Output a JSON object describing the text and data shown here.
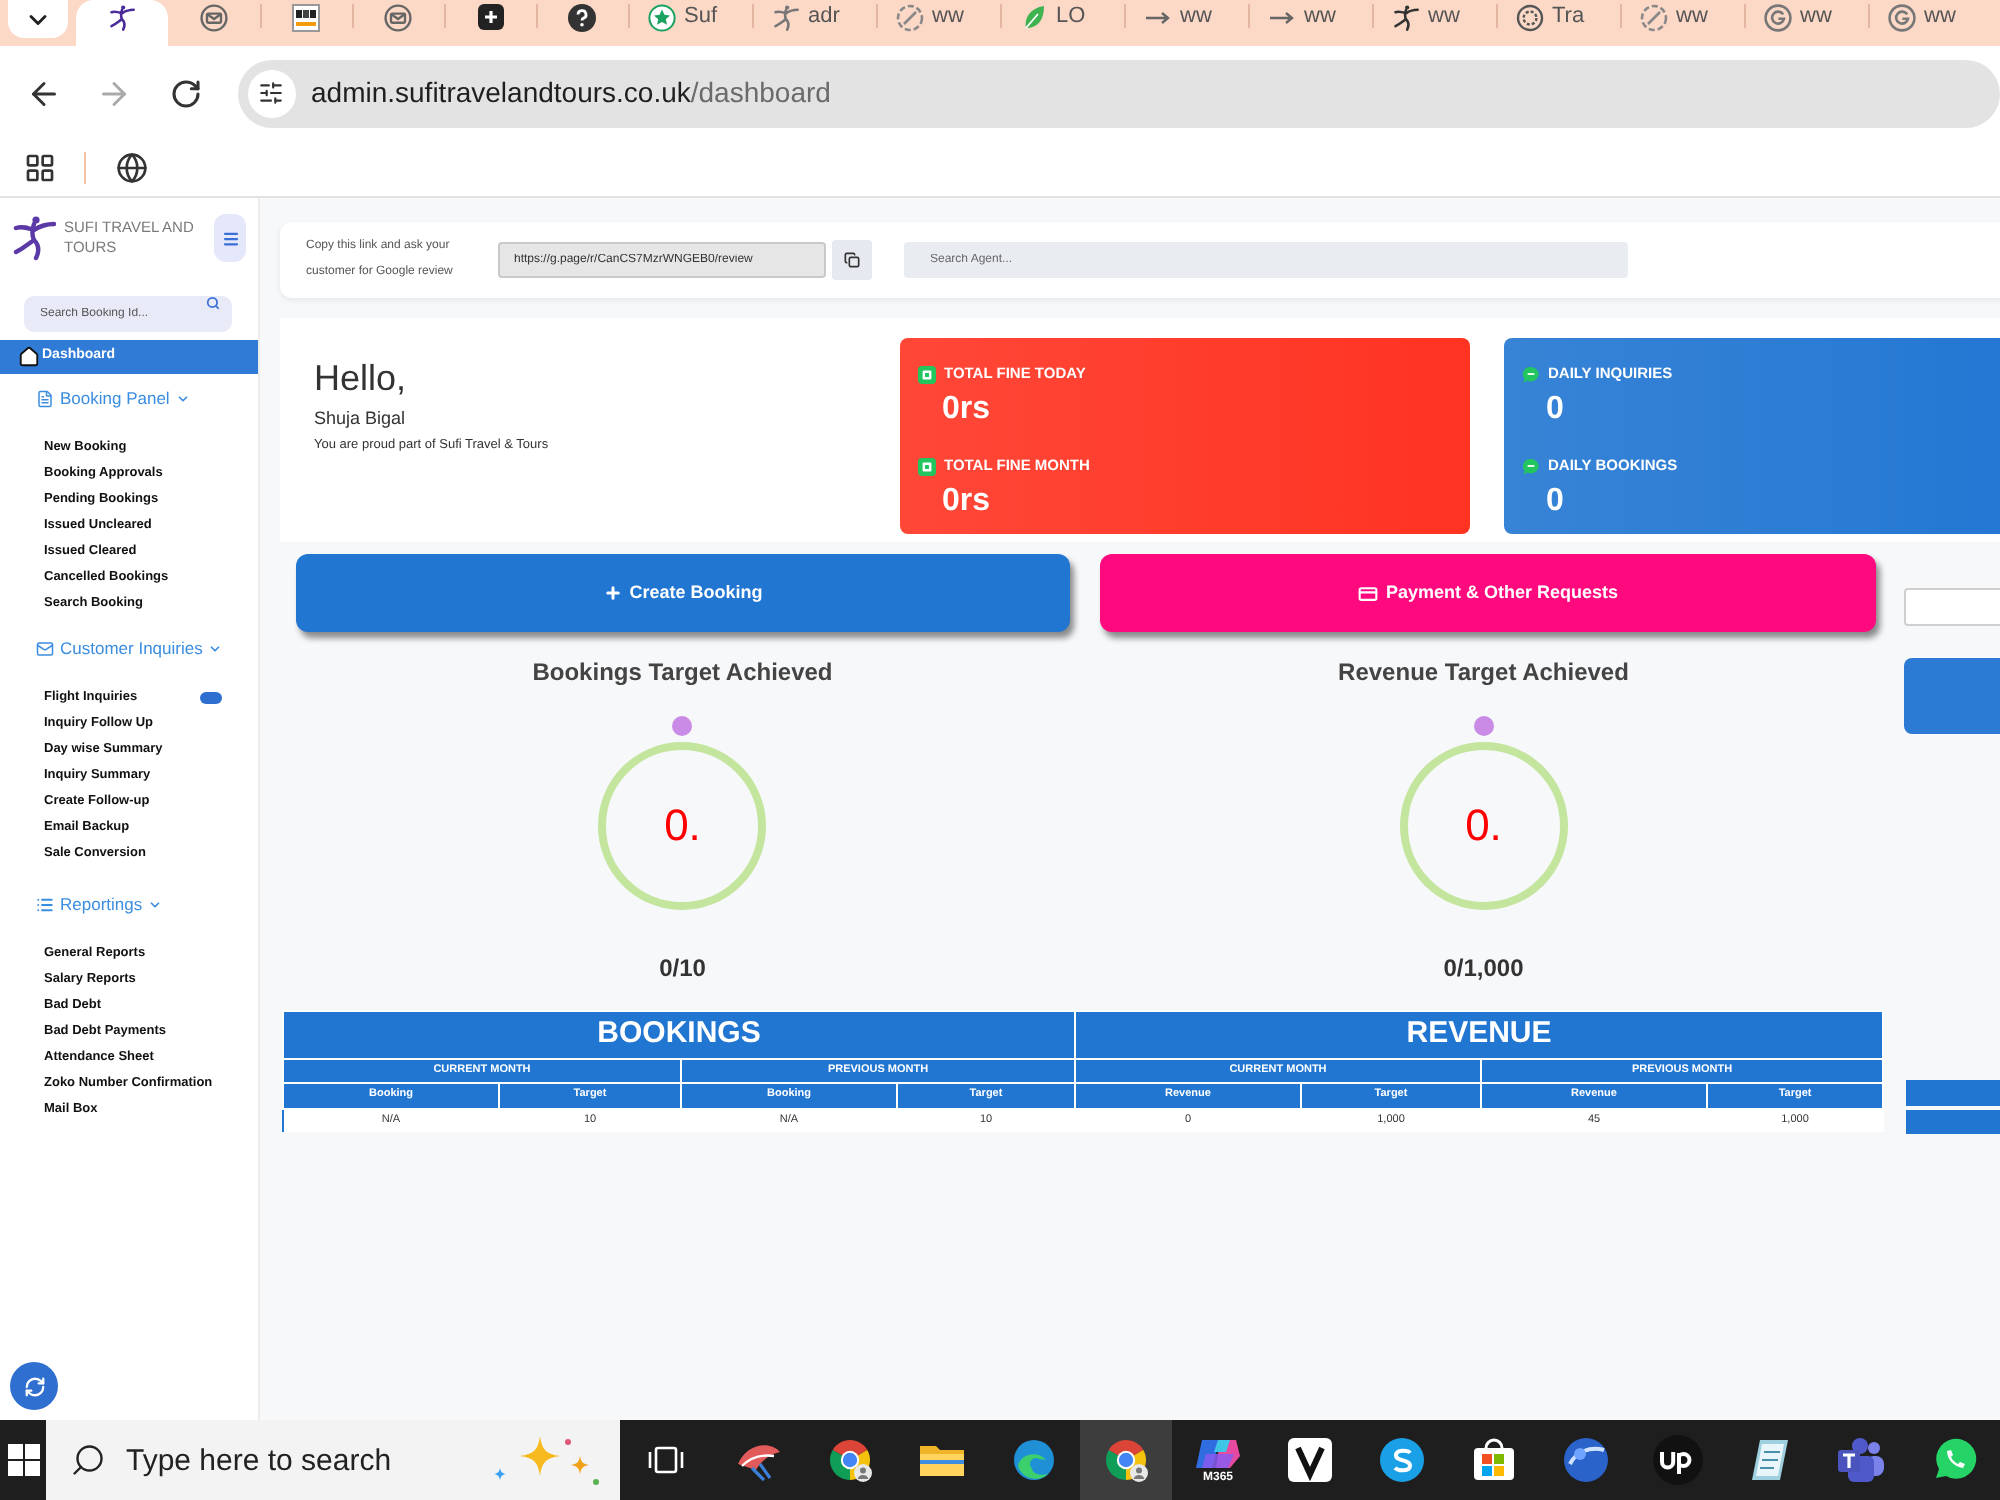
{
  "browser": {
    "tabs": [
      {
        "selected": true
      },
      {
        "selected": false
      },
      {
        "selected": false
      },
      {
        "selected": false
      },
      {
        "selected": false
      },
      {
        "selected": false
      },
      {
        "title": "Suf",
        "selected": false
      },
      {
        "title": "adr",
        "selected": false
      },
      {
        "title": "ww",
        "selected": false
      },
      {
        "title": "LO",
        "selected": false
      },
      {
        "title": "ww",
        "selected": false
      },
      {
        "title": "ww",
        "selected": false
      },
      {
        "title": "ww",
        "selected": false
      },
      {
        "title": "Tra",
        "selected": false
      },
      {
        "title": "ww",
        "selected": false
      },
      {
        "title": "ww",
        "selected": false
      },
      {
        "title": "ww",
        "selected": false
      }
    ],
    "address": {
      "host": "admin.sufitravelandtours.co.uk",
      "path": "/dashboard"
    }
  },
  "sidebar": {
    "brand": "SUFI TRAVEL AND TOURS",
    "search": {
      "placeholder": "Search Booking Id..."
    },
    "items": [
      {
        "kind": "link",
        "label": "Dashboard",
        "selected": true
      },
      {
        "kind": "section",
        "label": "Booking Panel",
        "expanded": true,
        "children": [
          {
            "label": "New Booking",
            "badge": false
          },
          {
            "label": "Booking Approvals",
            "badge": false
          },
          {
            "label": "Pending Bookings",
            "badge": false
          },
          {
            "label": "Issued Uncleared",
            "badge": false
          },
          {
            "label": "Issued Cleared",
            "badge": false
          },
          {
            "label": "Cancelled Bookings",
            "badge": false
          },
          {
            "label": "Search Booking",
            "badge": false
          }
        ]
      },
      {
        "kind": "section",
        "label": "Customer Inquiries",
        "expanded": true,
        "children": [
          {
            "label": "Flight Inquiries",
            "badge": true
          },
          {
            "label": "Inquiry Follow Up",
            "badge": false
          },
          {
            "label": "Day wise Summary",
            "badge": false
          },
          {
            "label": "Inquiry Summary",
            "badge": false
          },
          {
            "label": "Create Follow-up",
            "badge": false
          },
          {
            "label": "Email Backup",
            "badge": false
          },
          {
            "label": "Sale Conversion",
            "badge": false
          }
        ]
      },
      {
        "kind": "section",
        "label": "Reportings",
        "expanded": true,
        "children": [
          {
            "label": "General Reports",
            "badge": false
          },
          {
            "label": "Salary Reports",
            "badge": false
          },
          {
            "label": "Bad Debt",
            "badge": false
          },
          {
            "label": "Bad Debt Payments",
            "badge": false
          },
          {
            "label": "Attendance Sheet",
            "badge": false
          },
          {
            "label": "Zoko Number Confirmation",
            "badge": false
          },
          {
            "label": "Mail Box",
            "badge": false
          }
        ]
      }
    ]
  },
  "header": {
    "review_prompt": "Copy this link and ask your customer for Google review",
    "review_link": "https://g.page/r/CanCS7MzrWNGEB0/review",
    "agent_search": {
      "placeholder": "Search Agent..."
    }
  },
  "welcome": {
    "greeting": "Hello,",
    "name": "Shuja Bigal",
    "tagline": "You are proud part of Sufi Travel & Tours"
  },
  "stat_cards": [
    {
      "color": "#ff3322",
      "stats": [
        {
          "label": "TOTAL FINE TODAY",
          "value": "0rs"
        },
        {
          "label": "TOTAL FINE MONTH",
          "value": "0rs"
        }
      ]
    },
    {
      "color": "#2176d2",
      "stats": [
        {
          "label": "DAILY INQUIRIES",
          "value": "0"
        },
        {
          "label": "DAILY BOOKINGS",
          "value": "0"
        }
      ]
    }
  ],
  "actions": [
    {
      "label": "Create Booking",
      "color": "#2176d2"
    },
    {
      "label": "Payment & Other Requests",
      "color": "#ff0a7e"
    }
  ],
  "gauges": [
    {
      "title": "Bookings Target Achieved",
      "value": "0.",
      "reading": "0/10"
    },
    {
      "title": "Revenue Target Achieved",
      "value": "0.",
      "reading": "0/1,000"
    }
  ],
  "summary_table": {
    "groups": [
      {
        "title": "BOOKINGS",
        "periods": [
          {
            "title": "CURRENT MONTH",
            "columns": [
              {
                "heading": "Booking",
                "value": "N/A"
              },
              {
                "heading": "Target",
                "value": "10"
              }
            ]
          },
          {
            "title": "PREVIOUS MONTH",
            "columns": [
              {
                "heading": "Booking",
                "value": "N/A"
              },
              {
                "heading": "Target",
                "value": "10"
              }
            ]
          }
        ]
      },
      {
        "title": "REVENUE",
        "periods": [
          {
            "title": "CURRENT MONTH",
            "columns": [
              {
                "heading": "Revenue",
                "value": "0"
              },
              {
                "heading": "Target",
                "value": "1,000"
              }
            ]
          },
          {
            "title": "PREVIOUS MONTH",
            "columns": [
              {
                "heading": "Revenue",
                "value": "45"
              },
              {
                "heading": "Target",
                "value": "1,000"
              }
            ]
          }
        ]
      }
    ]
  },
  "taskbar": {
    "search": {
      "placeholder": "Type here to search"
    },
    "apps": [
      {
        "selected": false
      },
      {
        "selected": false
      },
      {
        "selected": false
      },
      {
        "selected": false
      },
      {
        "selected": false
      },
      {
        "selected": true
      },
      {
        "caption": "M365",
        "selected": false
      },
      {
        "selected": false
      },
      {
        "selected": false
      },
      {
        "selected": false
      },
      {
        "selected": false
      },
      {
        "selected": false
      },
      {
        "selected": false
      },
      {
        "selected": false
      },
      {
        "selected": false
      }
    ]
  }
}
